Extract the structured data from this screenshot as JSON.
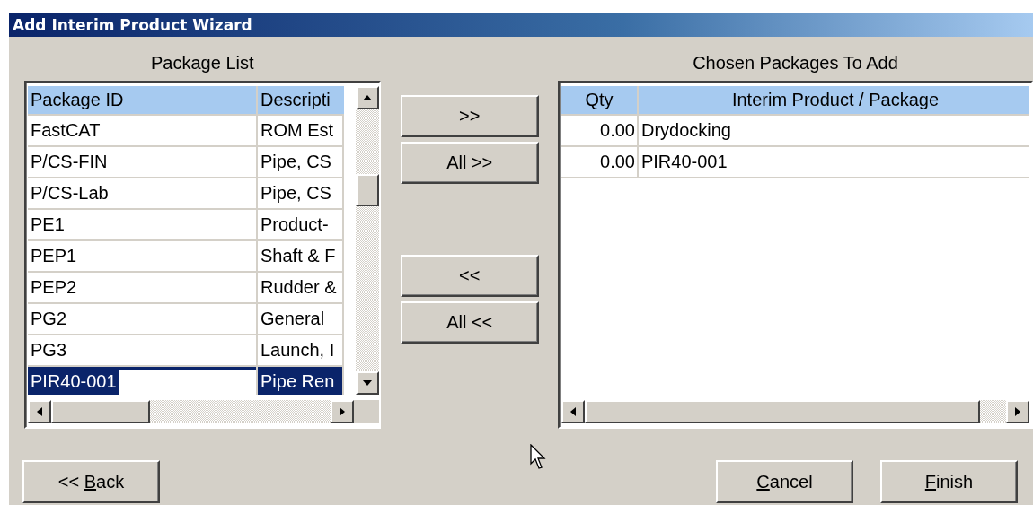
{
  "window": {
    "title": "Add Interim Product Wizard"
  },
  "package_list": {
    "label": "Package List",
    "columns": [
      "Package ID",
      "Descripti"
    ],
    "rows": [
      {
        "id": "FastCAT",
        "description": "ROM Est",
        "selected": false
      },
      {
        "id": "P/CS-FIN",
        "description": "Pipe, CS",
        "selected": false
      },
      {
        "id": "P/CS-Lab",
        "description": "Pipe, CS",
        "selected": false
      },
      {
        "id": "PE1",
        "description": "Product-",
        "selected": false
      },
      {
        "id": "PEP1",
        "description": "Shaft & F",
        "selected": false
      },
      {
        "id": "PEP2",
        "description": "Rudder &",
        "selected": false
      },
      {
        "id": "PG2",
        "description": "General",
        "selected": false
      },
      {
        "id": "PG3",
        "description": "Launch, I",
        "selected": false
      },
      {
        "id": "PIR40-001",
        "description": "Pipe Ren",
        "selected": true
      }
    ]
  },
  "move_buttons": [
    {
      "label": ">>"
    },
    {
      "label": "All >>"
    },
    {
      "label": "<<"
    },
    {
      "label": "All <<"
    }
  ],
  "chosen_list": {
    "label": "Chosen Packages To Add",
    "columns": [
      "Qty",
      "Interim Product / Package"
    ],
    "rows": [
      {
        "qty": "0.00",
        "package": "Drydocking"
      },
      {
        "qty": "0.00",
        "package": "PIR40-001"
      }
    ]
  },
  "footer_buttons": [
    {
      "pre": "<< ",
      "key": "B",
      "post": "ack"
    },
    {
      "key": "C",
      "post": "ancel"
    },
    {
      "key": "F",
      "post": "inish"
    }
  ]
}
